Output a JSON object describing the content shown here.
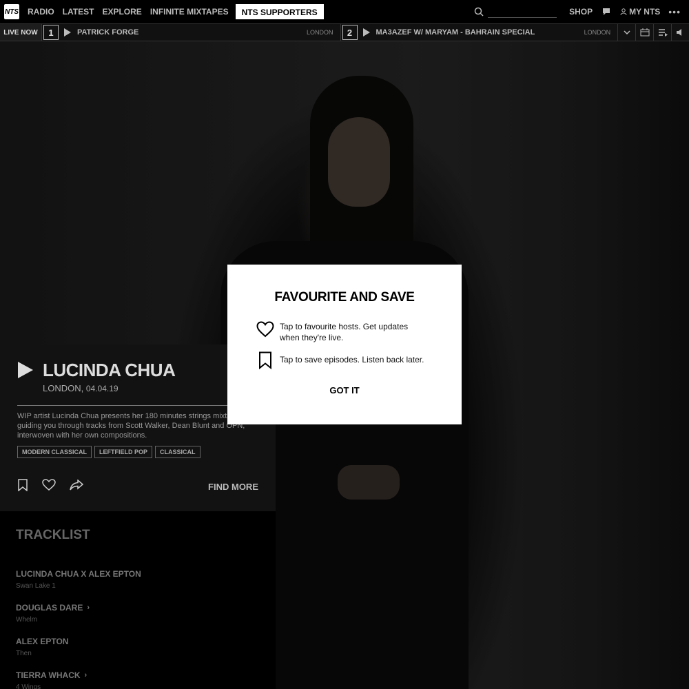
{
  "topnav": {
    "logo": "NTS",
    "links": [
      "RADIO",
      "LATEST",
      "EXPLORE",
      "INFINITE MIXTAPES"
    ],
    "supporters": "NTS SUPPORTERS",
    "search_placeholder": "",
    "shop": "SHOP",
    "my_nts": "MY NTS",
    "more": "•••"
  },
  "livebar": {
    "live_now": "LIVE NOW",
    "channels": [
      {
        "number": "1",
        "title": "PATRICK FORGE",
        "location": "LONDON"
      },
      {
        "number": "2",
        "title": "MA3AZEF W/ MARYAM - BAHRAIN SPECIAL",
        "location": "LONDON"
      }
    ]
  },
  "episode": {
    "title": "LUCINDA CHUA",
    "location": "LONDON,",
    "date": "04.04.19",
    "description": "WIP artist Lucinda Chua presents her 180 minutes strings mixtape, guiding you through tracks from Scott Walker, Dean Blunt and OPN, interwoven with her own compositions.",
    "tags": [
      "MODERN CLASSICAL",
      "LEFTFIELD POP",
      "CLASSICAL"
    ],
    "find_more": "FIND MORE"
  },
  "tracklist": {
    "title": "TRACKLIST",
    "tracks": [
      {
        "artist": "LUCINDA CHUA X ALEX EPTON",
        "title": "Swan Lake 1",
        "link": false
      },
      {
        "artist": "DOUGLAS DARE",
        "title": "Whelm",
        "link": true
      },
      {
        "artist": "ALEX EPTON",
        "title": "Then",
        "link": false
      },
      {
        "artist": "TIERRA WHACK",
        "title": "4 Wings",
        "link": true
      }
    ]
  },
  "modal": {
    "title": "FAVOURITE AND SAVE",
    "favourite_text": "Tap to favourite hosts. Get updates when they're live.",
    "save_text": "Tap to save episodes. Listen back later.",
    "button": "GOT IT"
  }
}
